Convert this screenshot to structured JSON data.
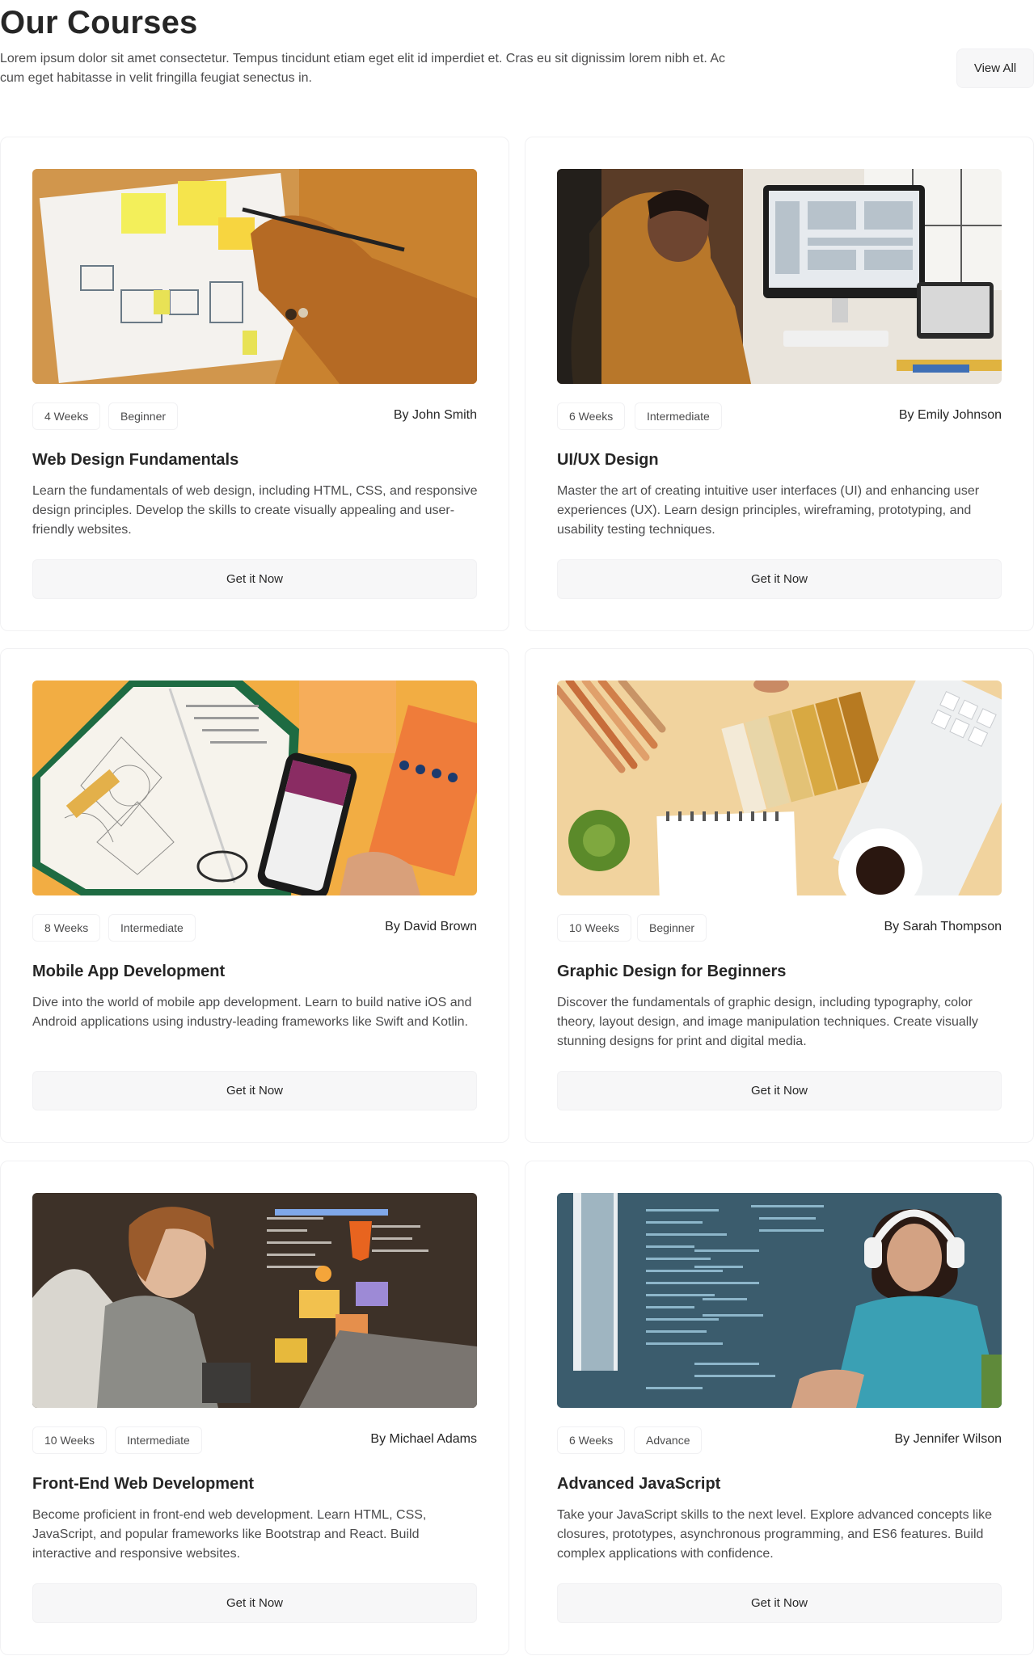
{
  "header": {
    "title": "Our Courses",
    "description": "Lorem ipsum dolor sit amet consectetur. Tempus tincidunt etiam eget elit id imperdiet et. Cras eu sit dignissim lorem nibh et. Ac cum eget habitasse in velit fringilla feugiat senectus in.",
    "view_all_label": "View All"
  },
  "courses": [
    {
      "duration": "4 Weeks",
      "level": "Beginner",
      "author": "By John Smith",
      "title": "Web Design Fundamentals",
      "description": "Learn the fundamentals of web design, including HTML, CSS, and responsive design principles. Develop the skills to create visually appealing and user-friendly websites.",
      "cta": "Get it Now"
    },
    {
      "duration": "6 Weeks",
      "level": "Intermediate",
      "author": "By Emily Johnson",
      "title": "UI/UX Design",
      "description": "Master the art of creating intuitive user interfaces (UI) and enhancing user experiences (UX). Learn design principles, wireframing, prototyping, and usability testing techniques.",
      "cta": "Get it Now"
    },
    {
      "duration": "8 Weeks",
      "level": "Intermediate",
      "author": "By David Brown",
      "title": "Mobile App Development",
      "description": "Dive into the world of mobile app development. Learn to build native iOS and Android applications using industry-leading frameworks like Swift and Kotlin.",
      "cta": "Get it Now"
    },
    {
      "duration": "10 Weeks",
      "level": "Beginner",
      "author": "By Sarah Thompson",
      "title": "Graphic Design for Beginners",
      "description": "Discover the fundamentals of graphic design, including typography, color theory, layout design, and image manipulation techniques. Create visually stunning designs for print and digital media.",
      "cta": "Get it Now"
    },
    {
      "duration": "10 Weeks",
      "level": "Intermediate",
      "author": "By Michael Adams",
      "title": "Front-End Web Development",
      "description": "Become proficient in front-end web development. Learn HTML, CSS, JavaScript, and popular frameworks like Bootstrap and React. Build interactive and responsive websites.",
      "cta": "Get it Now"
    },
    {
      "duration": "6 Weeks",
      "level": "Advance",
      "author": "By Jennifer Wilson",
      "title": "Advanced JavaScript",
      "description": "Take your JavaScript skills to the next level. Explore advanced concepts like closures, prototypes, asynchronous programming, and ES6 features. Build complex applications with confidence.",
      "cta": "Get it Now"
    }
  ]
}
